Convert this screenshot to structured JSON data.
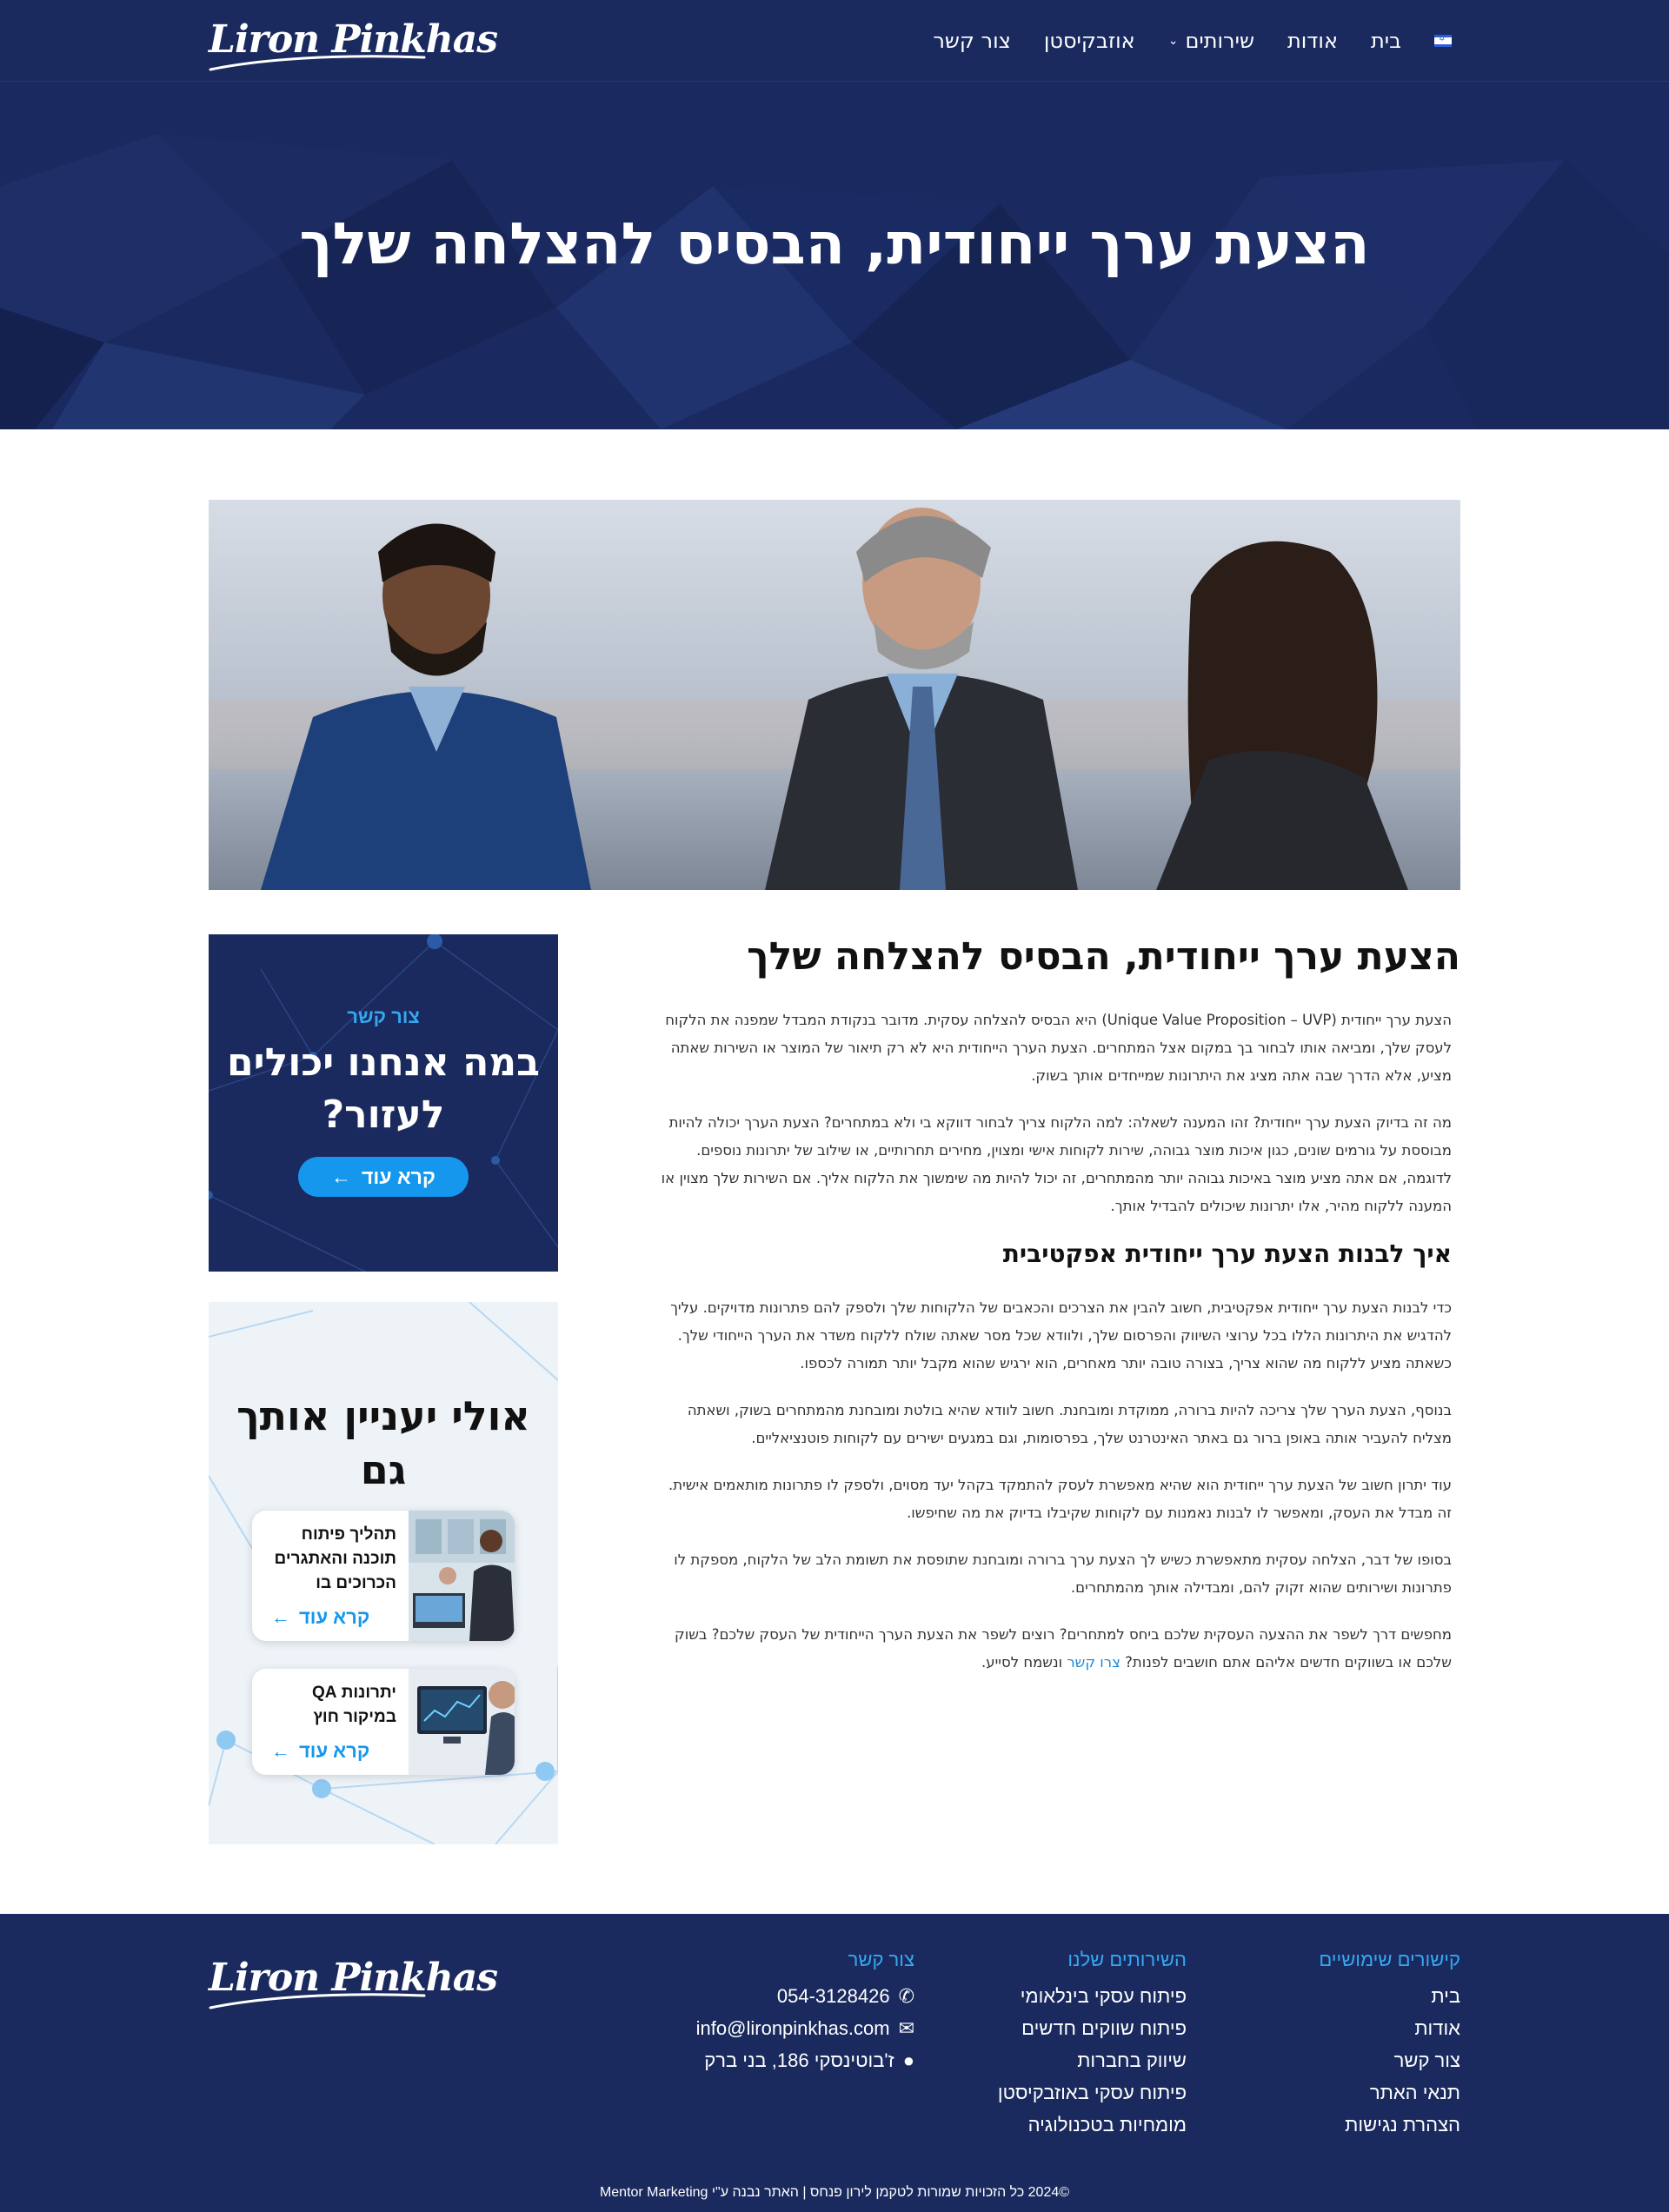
{
  "header": {
    "logo_text": "Liron Pinkhas",
    "nav": [
      {
        "label": "בית"
      },
      {
        "label": "אודות"
      },
      {
        "label": "שירותים"
      },
      {
        "label": "אוזבקיסטן"
      },
      {
        "label": "צור קשר"
      }
    ]
  },
  "hero": {
    "title": "הצעת ערך ייחודית, הבסיס להצלחה שלך"
  },
  "article": {
    "title": "הצעת ערך ייחודית, הבסיס להצלחה שלך",
    "p1": "הצעת ערך ייחודית (Unique Value Proposition – UVP) היא הבסיס להצלחה עסקית. מדובר בנקודת המבדל שמפנה את הלקוח לעסק שלך, ומביאה אותו לבחור בך במקום אצל המתחרים. הצעת הערך הייחודית היא לא רק תיאור של המוצר או השירות שאתה מציע, אלא הדרך שבה אתה מציג את היתרונות שמייחדים אותך בשוק.",
    "p2": "מה זה בדיוק הצעת ערך ייחודית? זהו המענה לשאלה: למה הלקוח צריך לבחור דווקא בי ולא במתחרים? הצעת הערך יכולה להיות מבוססת על גורמים שונים, כגון איכות מוצר גבוהה, שירות לקוחות אישי ומצוין, מחירים תחרותיים, או שילוב של יתרונות נוספים. לדוגמה, אם אתה מציע מוצר באיכות גבוהה יותר מהמתחרים, זה יכול להיות מה שימשוך את הלקוח אליך. אם השירות שלך מצוין או המענה ללקוח מהיר, אלו יתרונות שיכולים להבדיל אותך.",
    "h2": "איך לבנות הצעת ערך ייחודית אפקטיבית",
    "p3": "כדי לבנות הצעת ערך ייחודית אפקטיבית, חשוב להבין את הצרכים והכאבים של הלקוחות שלך ולספק להם פתרונות מדויקים. עליך להדגיש את היתרונות הללו בכל ערוצי השיווק והפרסום שלך, ולוודא שכל מסר שאתה שולח ללקוח משדר את הערך הייחודי שלך. כשאתה מציע ללקוח מה שהוא צריך, בצורה טובה יותר מאחרים, הוא ירגיש שהוא מקבל יותר תמורה לכספו.",
    "p4": "בנוסף, הצעת הערך שלך צריכה להיות ברורה, ממוקדת ומובחנת. חשוב לוודא שהיא בולטת ומובחנת מהמתחרים בשוק, ושאתה מצליח להעביר אותה באופן ברור גם באתר האינטרנט שלך, בפרסומות, וגם במגעים ישירים עם לקוחות פוטנציאליים.",
    "p5": "עוד יתרון חשוב של הצעת ערך ייחודית הוא שהיא מאפשרת לעסק להתמקד בקהל יעד מסוים, ולספק לו פתרונות מותאמים אישית. זה מבדל את העסק, ומאפשר לו לבנות נאמנות עם לקוחות שקיבלו בדיוק את מה שחיפשו.",
    "p6": "בסופו של דבר, הצלחה עסקית מתאפשרת כשיש לך הצעת ערך ברורה ומובחנת שתופסת את תשומת הלב של הלקוח, מספקת לו פתרונות ושירותים שהוא זקוק להם, ומבדילה אותך מהמתחרים.",
    "p7_before": "מחפשים דרך לשפר את ההצעה העסקית שלכם ביחס למתחרים? רוצים לשפר את הצעת הערך הייחודית של העסק שלכם? בשוק שלכם או בשווקים חדשים אליהם אתם חושבים לפנות? ",
    "p7_link": "צרו קשר",
    "p7_after": " ונשמח לסייע."
  },
  "cta": {
    "kicker": "צור קשר",
    "title": "במה אנחנו יכולים לעזור?",
    "button": "קרא עוד"
  },
  "related": {
    "title": "אולי יעניין אותך גם",
    "cards": [
      {
        "title": "תהליך פיתוח תוכנה והאתגרים הכרוכים בו",
        "link": "קרא עוד"
      },
      {
        "title": "יתרונות QA במיקור חוץ",
        "link": "קרא עוד"
      }
    ]
  },
  "footer": {
    "logo_text": "Liron Pinkhas",
    "useful_links": {
      "heading": "קישורים שימושיים",
      "items": [
        "בית",
        "אודות",
        "צור קשר",
        "תנאי האתר",
        "הצהרת נגישות"
      ]
    },
    "services": {
      "heading": "השירותים שלנו",
      "items": [
        "פיתוח עסקי בינלאומי",
        "פיתוח שווקים חדשים",
        "שיווק בחברות",
        "פיתוח עסקי באוזבקיסטן",
        "מומחיות בטכנולוגיה"
      ]
    },
    "contact": {
      "heading": "צור קשר",
      "phone": "054-3128426",
      "email": "info@lironpinkhas.com",
      "address": "ז'בוטינסקי 186, בני ברק"
    },
    "copyright": "©2024 כל הזכויות שמורות לטקמן לירון פנחס | האתר נבנה ע\"י Mentor Marketing"
  },
  "colors": {
    "navy": "#1a2a5e",
    "accent": "#1597ee",
    "accent_text": "#35a8f0"
  }
}
